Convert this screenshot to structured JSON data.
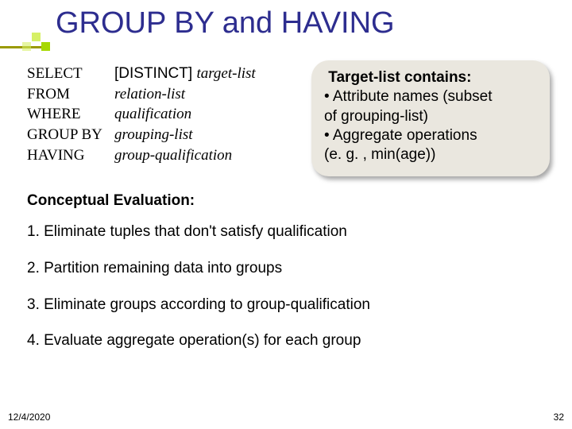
{
  "title": "GROUP BY and HAVING",
  "syntax": {
    "rows": [
      {
        "kw": "SELECT",
        "pre": "[DISTINCT] ",
        "arg": "target-list"
      },
      {
        "kw": "FROM",
        "pre": "",
        "arg": "relation-list"
      },
      {
        "kw": "WHERE",
        "pre": "",
        "arg": "qualification"
      },
      {
        "kw": "GROUP BY",
        "pre": "",
        "arg": "grouping-list"
      },
      {
        "kw": "HAVING",
        "pre": "",
        "arg": "group-qualification"
      }
    ]
  },
  "callout": {
    "heading": "Target-list contains:",
    "bullet1a": "• Attribute names (subset",
    "bullet1b": "of grouping-list)",
    "bullet2a": "• Aggregate operations",
    "bullet2b": "(e. g. , min(age))"
  },
  "conceptual_heading": "Conceptual Evaluation:",
  "steps": [
    "1.  Eliminate tuples that don't satisfy qualification",
    "2.  Partition remaining data into groups",
    "3.  Eliminate groups according to group-qualification",
    "4.  Evaluate aggregate operation(s) for each group"
  ],
  "footer": {
    "date": "12/4/2020",
    "page": "32"
  }
}
